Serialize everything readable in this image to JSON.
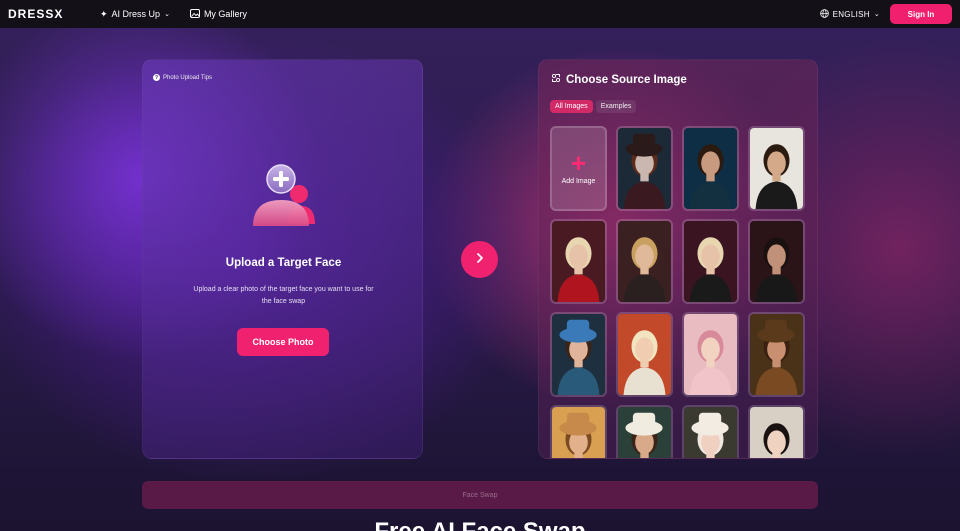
{
  "nav": {
    "logo": "DRESSX",
    "items": [
      {
        "label": "AI Dress Up",
        "icon": "sparkle-icon",
        "has_dropdown": true
      },
      {
        "label": "My Gallery",
        "icon": "gallery-icon",
        "has_dropdown": false
      }
    ],
    "language": "ENGLISH",
    "sign_in": "Sign In"
  },
  "left_panel": {
    "tips": "Photo Upload Tips",
    "title": "Upload a Target Face",
    "description": "Upload a clear photo of the target face you want to use for the face swap",
    "button": "Choose Photo"
  },
  "right_panel": {
    "title": "Choose Source Image",
    "tabs": [
      {
        "label": "All Images",
        "active": true
      },
      {
        "label": "Examples",
        "active": false
      }
    ],
    "add_label": "Add Image",
    "images": [
      {
        "icon": "mad-hatter-portrait",
        "bg": "#1c2a38",
        "skin": "#c9b7b0",
        "hair": "#5a2a1a",
        "cloth": "#3a1a20",
        "hat": "#2a1a1a"
      },
      {
        "icon": "neon-suit-portrait",
        "bg": "#0e2e45",
        "skin": "#c89a80",
        "hair": "#2b1a10",
        "cloth": "#12303f",
        "hat": ""
      },
      {
        "icon": "businessman-portrait",
        "bg": "#e8e4de",
        "skin": "#d4a98a",
        "hair": "#2b1a10",
        "cloth": "#1a1a1a",
        "hat": ""
      },
      {
        "icon": "red-devil-portrait",
        "bg": "#4a1a22",
        "skin": "#e6c2a8",
        "hair": "#e8d6b0",
        "cloth": "#b0141e",
        "hat": ""
      },
      {
        "icon": "blonde-woman-portrait",
        "bg": "#3a2020",
        "skin": "#e0b89a",
        "hair": "#c8a060",
        "cloth": "#2a2020",
        "hat": ""
      },
      {
        "icon": "blonde-devil-portrait",
        "bg": "#3a1420",
        "skin": "#e6c2a8",
        "hair": "#e8d6b0",
        "cloth": "#1a1a1a",
        "hat": ""
      },
      {
        "icon": "dark-man-portrait",
        "bg": "#2a1418",
        "skin": "#c09078",
        "hair": "#1a1010",
        "cloth": "#181818",
        "hat": ""
      },
      {
        "icon": "flower-crown-portrait",
        "bg": "#1e3040",
        "skin": "#e0b49a",
        "hair": "#3a2418",
        "cloth": "#2a5a7a",
        "hat": "#3a7ab8"
      },
      {
        "icon": "marilyn-gift-portrait",
        "bg": "#c24a2a",
        "skin": "#f0cdb0",
        "hair": "#f2e4c0",
        "cloth": "#e8e0d0",
        "hat": ""
      },
      {
        "icon": "pink-fox-portrait",
        "bg": "#e8bcc0",
        "skin": "#f2d2c0",
        "hair": "#d88a9a",
        "cloth": "#f0c4c8",
        "hat": ""
      },
      {
        "icon": "cowboy-portrait",
        "bg": "#4a3218",
        "skin": "#c89070",
        "hair": "#3a2010",
        "cloth": "#7a4a22",
        "hat": "#5a3a1a"
      },
      {
        "icon": "cowgirl-portrait",
        "bg": "#d8a050",
        "skin": "#e2b08a",
        "hair": "#7a4a22",
        "cloth": "#a06030",
        "hat": "#c88a4a"
      },
      {
        "icon": "white-hat-man-portrait",
        "bg": "#2a4038",
        "skin": "#d8aa8a",
        "hair": "#3a2418",
        "cloth": "#203030",
        "hat": "#f0ece0"
      },
      {
        "icon": "headdress-portrait",
        "bg": "#3a3a30",
        "skin": "#f0d0c0",
        "hair": "#f0e8e0",
        "cloth": "#e0d8cc",
        "hat": "#f2ece2"
      },
      {
        "icon": "asian-woman-portrait",
        "bg": "#d8d0c4",
        "skin": "#f0d2c0",
        "hair": "#1a1210",
        "cloth": "#e8e0d8",
        "hat": ""
      }
    ]
  },
  "face_swap_button": "Face Swap",
  "bottom_heading": "Free AI Face Swap"
}
